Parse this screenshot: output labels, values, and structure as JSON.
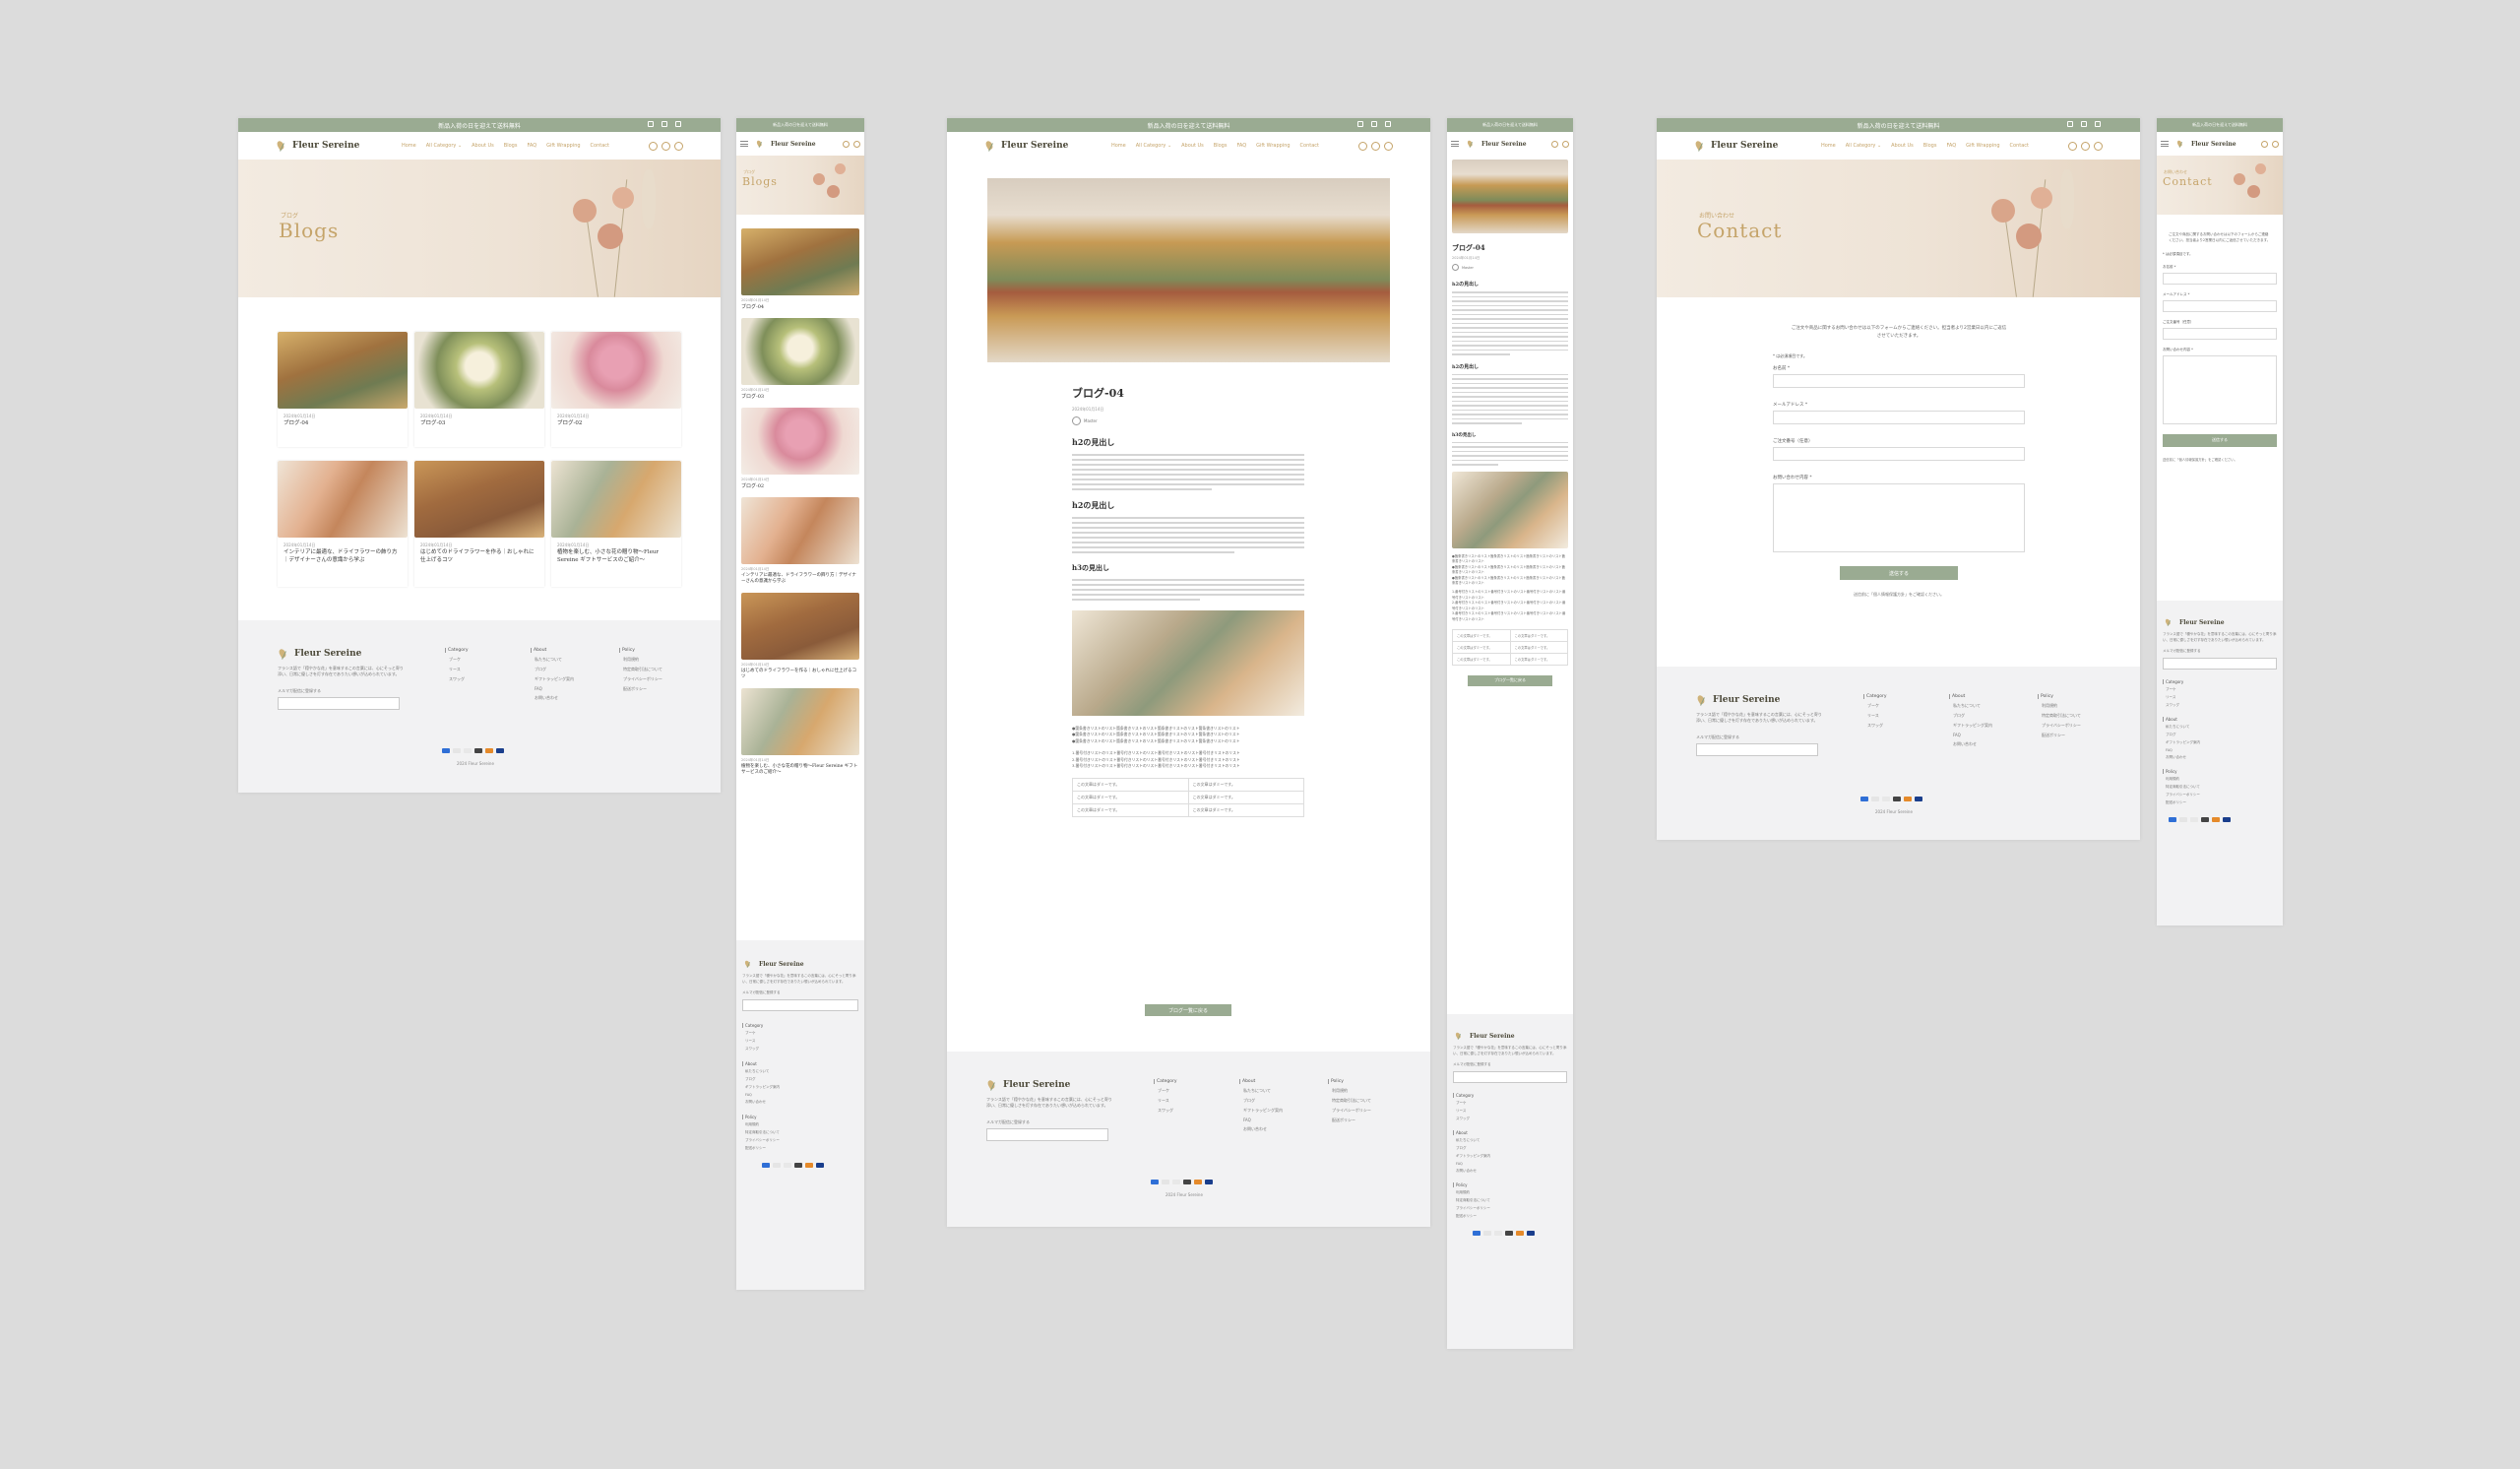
{
  "site": {
    "brand": "Fleur Sereine",
    "announcement": "新品入荷の日を迎えて送料無料",
    "nav": [
      "Home",
      "All Category ⌄",
      "About Us",
      "Blogs",
      "FAQ",
      "Gift Wrapping",
      "Contact"
    ]
  },
  "blogs_page": {
    "hero_sub": "ブログ",
    "hero_title": "Blogs",
    "posts": [
      {
        "date": "2024年01月14日",
        "title": "ブログ-04"
      },
      {
        "date": "2024年01月14日",
        "title": "ブログ-03"
      },
      {
        "date": "2024年01月14日",
        "title": "ブログ-02"
      },
      {
        "date": "2024年01月14日",
        "title": "インテリアに最適な、ドライフラワーの飾り方｜デザイナーさんの意識から学ぶ"
      },
      {
        "date": "2024年01月14日",
        "title": "はじめてのドライフラワーを作る｜おしゃれに仕上げるコツ"
      },
      {
        "date": "2024年01月14日",
        "title": "植物を楽しむ、小さな花の贈り物～Fleur Sereine ギフトサービスのご紹介～"
      }
    ]
  },
  "article_page": {
    "title": "ブログ-04",
    "date": "2024年01月14日",
    "author": "Master",
    "sections": [
      "h2の見出し",
      "h2の見出し",
      "h3の見出し"
    ],
    "body_text": "この文章はダミーです。文字の大きさ、量、字間、行間等を確認するために入れています。この文章はダミーです。文字の大きさ、量、字間、行間等を確認するために入れています。",
    "list_items": [
      "●箇条書きリストのリスト箇条書きリストのリスト箇条書きリストのリスト箇条書きリストのリスト",
      "●箇条書きリストのリスト箇条書きリストのリスト箇条書きリストのリスト箇条書きリストのリスト",
      "●箇条書きリストのリスト箇条書きリストのリスト箇条書きリストのリスト箇条書きリストのリスト",
      "1.番号付きリストのリスト番号付きリストのリスト番号付きリストのリスト番号付きリストのリスト",
      "2.番号付きリストのリスト番号付きリストのリスト番号付きリストのリスト番号付きリストのリスト",
      "3.番号付きリストのリスト番号付きリストのリスト番号付きリストのリスト番号付きリストのリスト"
    ],
    "table_cell": "この文章はダミーです。",
    "back_button": "ブログ一覧に戻る"
  },
  "contact_page": {
    "hero_sub": "お問い合わせ",
    "hero_title": "Contact",
    "intro": "ご注文や商品に関するお問い合わせは以下のフォームからご連絡ください。担当者より2営業日以内にご返信させていただきます。",
    "required_note": "* は必須項目です。",
    "fields": [
      "お名前 *",
      "メールアドレス *",
      "ご注文番号（任意）",
      "お問い合わせ内容 *"
    ],
    "submit": "送信する",
    "privacy": "送信前に「個人情報保護方針」をご確認ください。"
  },
  "footer": {
    "desc": "フランス語で「穏やかな花」を意味するこの言葉には、心にそっと寄り添い、日常に優しさを灯す存在でありたい想いが込められています。",
    "newsletter_label": "メルマガ配信に登録する",
    "col1_head": "Category",
    "col1": [
      "ブーケ",
      "リース",
      "スワッグ"
    ],
    "col2_head": "About",
    "col2": [
      "私たちについて",
      "ブログ",
      "ギフトラッピング案内",
      "FAQ",
      "お問い合わせ"
    ],
    "col3_head": "Policy",
    "col3": [
      "利用規約",
      "特定商取引法について",
      "プライバシーポリシー",
      "配送ポリシー"
    ],
    "copyright": "2024 Fleur Sereine"
  },
  "colors": {
    "accent": "#9aab92",
    "gold": "#c5a46a",
    "background": "#dcdcdc"
  }
}
